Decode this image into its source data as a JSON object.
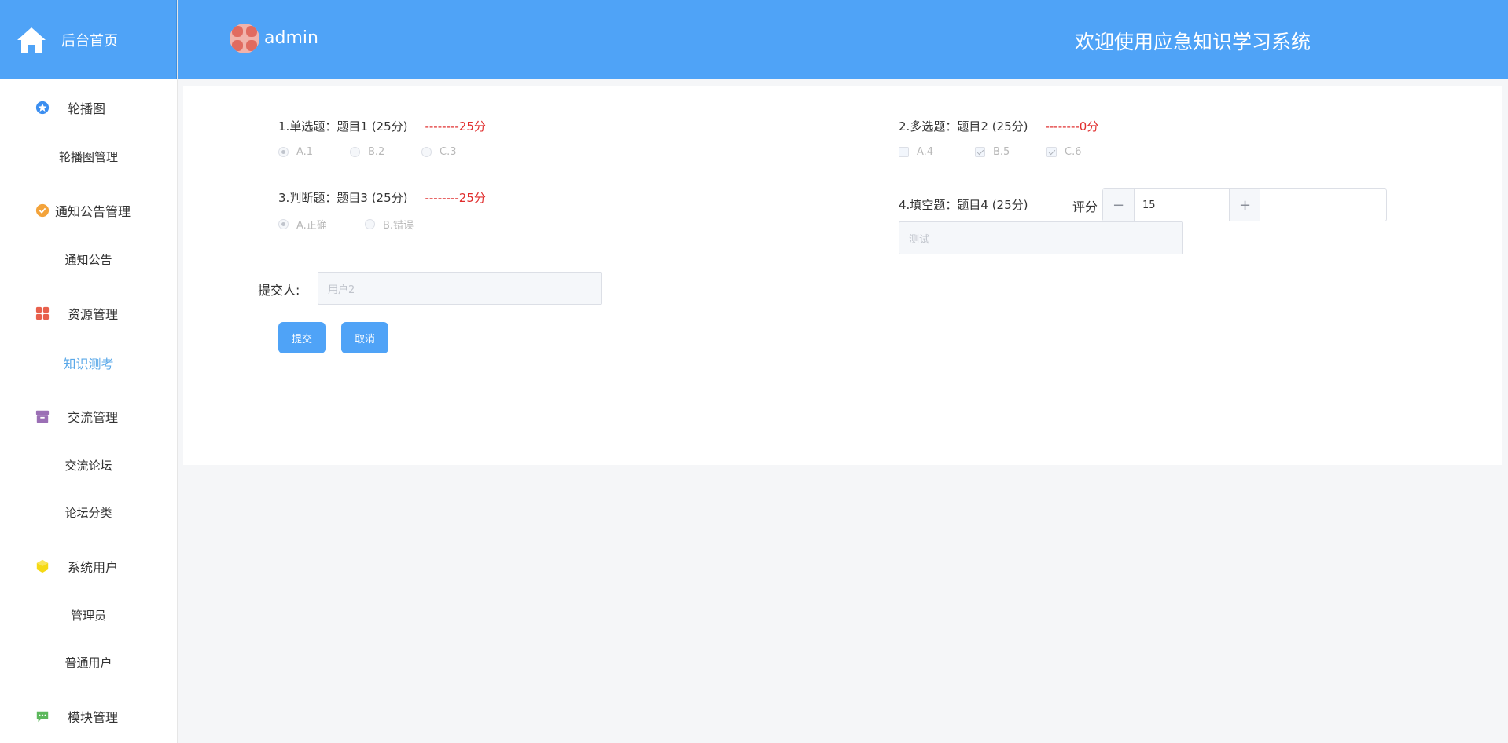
{
  "sidebar": {
    "home_label": "后台首页",
    "groups": [
      {
        "label": "轮播图",
        "icon": "star-icon",
        "color": "#3b8ef0",
        "subs": [
          "轮播图管理"
        ]
      },
      {
        "label": "通知公告管理",
        "icon": "badge-icon",
        "color": "#f3a33b",
        "subs": [
          "通知公告"
        ]
      },
      {
        "label": "资源管理",
        "icon": "grid-icon",
        "color": "#e8604c",
        "subs": [
          "知识测考"
        ]
      },
      {
        "label": "交流管理",
        "icon": "box-icon",
        "color": "#9b6fb5",
        "subs": [
          "交流论坛",
          "论坛分类"
        ]
      },
      {
        "label": "系统用户",
        "icon": "cube-icon",
        "color": "#f5d915",
        "subs": [
          "管理员",
          "普通用户"
        ]
      },
      {
        "label": "模块管理",
        "icon": "chat-icon",
        "color": "#5cb85c",
        "subs": []
      }
    ],
    "active_sub": "知识测考"
  },
  "header": {
    "username": "admin",
    "title": "欢迎使用应急知识学习系统"
  },
  "questions": [
    {
      "number": "1",
      "type": "单选题",
      "title": "题目1",
      "points": "(25分)",
      "score": "--------25分",
      "options": [
        {
          "label": "A.1",
          "checked": true
        },
        {
          "label": "B.2",
          "checked": false
        },
        {
          "label": "C.3",
          "checked": false
        }
      ]
    },
    {
      "number": "2",
      "type": "多选题",
      "title": "题目2",
      "points": "(25分)",
      "score": "--------0分",
      "options": [
        {
          "label": "A.4",
          "checked": false
        },
        {
          "label": "B.5",
          "checked": true
        },
        {
          "label": "C.6",
          "checked": true
        }
      ]
    },
    {
      "number": "3",
      "type": "判断题",
      "title": "题目3",
      "points": "(25分)",
      "score": "--------25分",
      "options": [
        {
          "label": "A.正确",
          "checked": true
        },
        {
          "label": "B.错误",
          "checked": false
        }
      ]
    },
    {
      "number": "4",
      "type": "填空题",
      "title": "题目4",
      "points": "(25分)",
      "answer": "测试",
      "rating_label": "评分",
      "rating_value": "15"
    }
  ],
  "form": {
    "submitter_label": "提交人:",
    "submitter_value": "用户2",
    "submit_label": "提交",
    "cancel_label": "取消"
  },
  "colors": {
    "primary": "#4fa3f7",
    "score_red": "#e02d2d",
    "active_menu": "#5aa8e8"
  }
}
